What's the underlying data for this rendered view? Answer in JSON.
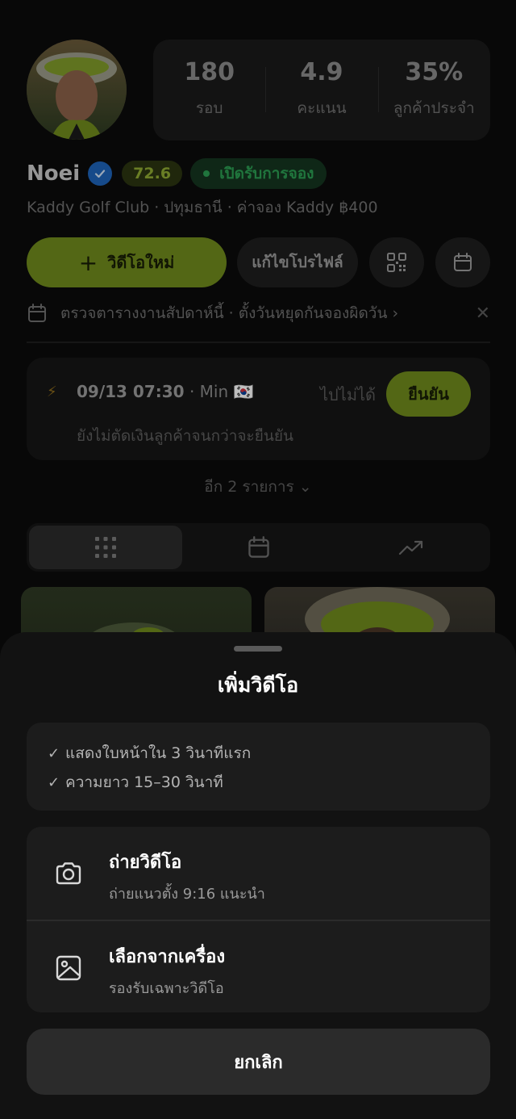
{
  "profile": {
    "name": "Noei",
    "score": "72.6",
    "status": "เปิดรับการจอง",
    "subline": "Kaddy Golf Club · ปทุมธานี · ค่าจอง Kaddy ฿400"
  },
  "stats": [
    {
      "value": "180",
      "label": "รอบ"
    },
    {
      "value": "4.9",
      "label": "คะแนน"
    },
    {
      "value": "35%",
      "label": "ลูกค้าประจำ"
    }
  ],
  "actions": {
    "new_video": "วิดีโอใหม่",
    "edit_profile": "แก้ไขโปรไฟล์"
  },
  "notice": {
    "text": "ตรวจตารางงานสัปดาห์นี้ · ตั้งวันหยุดกันจองผิดวัน ›"
  },
  "booking": {
    "time": "09/13 07:30",
    "customer": " · Min 🇰🇷",
    "decline": "ไปไม่ได้",
    "confirm": "ยืนยัน",
    "note": "ยังไม่ตัดเงินลูกค้าจนกว่าจะยืนยัน"
  },
  "more": "อีก 2 รายการ ⌄",
  "tabs": [
    {
      "icon": "grid-icon",
      "active": true
    },
    {
      "icon": "calendar-icon",
      "active": false
    },
    {
      "icon": "trend-icon",
      "active": false
    }
  ],
  "sheet": {
    "title": "เพิ่มวิดีโอ",
    "tips": [
      "แสดงใบหน้าใน 3 วินาทีแรก",
      "ความยาว 15–30 วินาที"
    ],
    "options": [
      {
        "title": "ถ่ายวิดีโอ",
        "subtitle": "ถ่ายแนวตั้ง 9:16 แนะนำ",
        "icon": "camera-icon"
      },
      {
        "title": "เลือกจากเครื่อง",
        "subtitle": "รองรับเฉพาะวิดีโอ",
        "icon": "image-icon"
      }
    ],
    "cancel": "ยกเลิก"
  },
  "colors": {
    "accent": "#98c22a",
    "background": "#000000",
    "sheet": "#121212"
  }
}
